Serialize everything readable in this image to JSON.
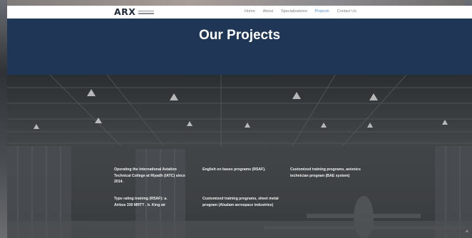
{
  "nav": {
    "logo": "ARX",
    "links": [
      {
        "label": "Home",
        "active": false
      },
      {
        "label": "About",
        "active": false
      },
      {
        "label": "Specializations",
        "active": false
      },
      {
        "label": "Projects",
        "active": true
      },
      {
        "label": "Contact Us",
        "active": false
      }
    ],
    "active_color": "#5b8fd0"
  },
  "hero": {
    "title": "Our Projects",
    "background": "#1f3656"
  },
  "projects": [
    {
      "text": "Operating the International Aviation Technical College at Riyadh (IATC) since 2014."
    },
    {
      "text": "English on bases programs (RSAF)."
    },
    {
      "text": "Customized training programs, avionics technician program (BAE system)"
    },
    {
      "text": "Type rating training (RSAF): a. Airbus 330 MRTT . b. King air"
    },
    {
      "text": "Customized training programs, sheet metal program (Alsalam aerospace industries)"
    }
  ],
  "scroll_top_icon": "chevron-up-icon"
}
